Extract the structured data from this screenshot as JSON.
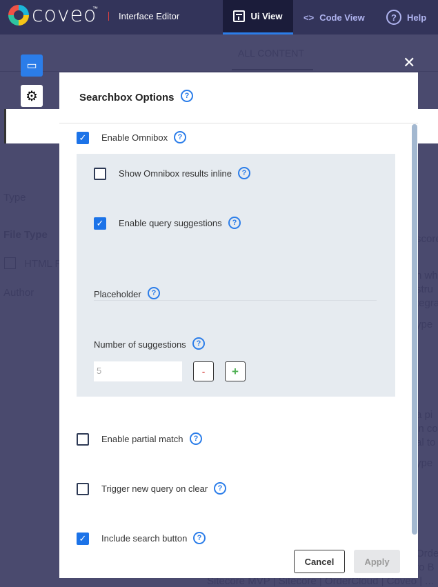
{
  "header": {
    "logo": "coveo",
    "tm": "™",
    "title": "Interface Editor",
    "tabs": [
      {
        "label": "Ui View",
        "icon": "layout-icon",
        "active": true
      },
      {
        "label": "Code View",
        "icon": "code-icon"
      },
      {
        "label": "Help",
        "icon": "help-circle-icon"
      }
    ]
  },
  "background": {
    "tab": "ALL CONTENT",
    "facets": [
      "Type",
      "File Type",
      "HTML F",
      "Author"
    ],
    "fragments": [
      "score",
      "n wh",
      "stru",
      "tegra",
      "ype",
      "a pi",
      "in co",
      "al to",
      "ype",
      "Orde",
      "to B",
      "Sitecore MVP | Sitecore | OrderCloud | Coveo | ..."
    ]
  },
  "modal": {
    "title": "Searchbox Options",
    "close": "✕",
    "options": [
      {
        "label": "Enable Omnibox",
        "checked": true
      },
      {
        "label": "Show Omnibox results inline",
        "checked": false
      },
      {
        "label": "Enable query suggestions",
        "checked": true
      },
      {
        "label": "Enable partial match",
        "checked": false
      },
      {
        "label": "Trigger new query on clear",
        "checked": false
      },
      {
        "label": "Include search button",
        "checked": true
      }
    ],
    "placeholder_label": "Placeholder",
    "placeholder_value": "",
    "suggestions_label": "Number of suggestions",
    "suggestions_value": "5",
    "minus": "-",
    "plus": "+",
    "cancel": "Cancel",
    "apply": "Apply"
  },
  "colors": {
    "accent": "#1c73e8",
    "header": "#33345a"
  }
}
